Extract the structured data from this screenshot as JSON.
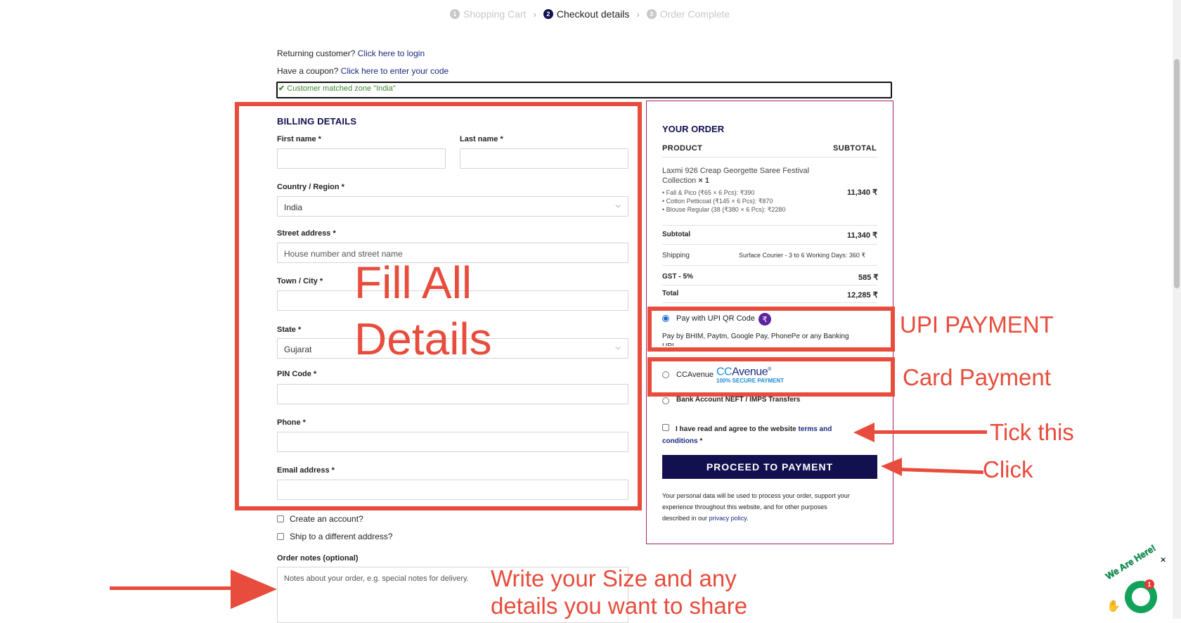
{
  "steps": [
    {
      "num": "1",
      "label": "Shopping Cart"
    },
    {
      "num": "2",
      "label": "Checkout details"
    },
    {
      "num": "3",
      "label": "Order Complete"
    }
  ],
  "returning": {
    "text": "Returning customer?",
    "link": "Click here to login"
  },
  "coupon": {
    "text": "Have a coupon?",
    "link": "Click here to enter your code"
  },
  "zone_message": "Customer matched zone \"India\"",
  "billing": {
    "title": "BILLING DETAILS",
    "first_name_label": "First name *",
    "last_name_label": "Last name *",
    "country_label": "Country / Region *",
    "country_value": "India",
    "street_label": "Street address *",
    "street_placeholder": "House number and street name",
    "town_label": "Town / City *",
    "state_label": "State *",
    "state_value": "Gujarat",
    "pin_label": "PIN Code *",
    "phone_label": "Phone *",
    "email_label": "Email address *",
    "create_account": "Create an account?",
    "ship_different": "Ship to a different address?",
    "notes_label": "Order notes (optional)",
    "notes_placeholder": "Notes about your order, e.g. special notes for delivery."
  },
  "order": {
    "title": "YOUR ORDER",
    "col_product": "PRODUCT",
    "col_subtotal": "SUBTOTAL",
    "item_name_line1": "Laxmi 926 Creap Georgette Saree Festival",
    "item_name_line2": "Collection",
    "item_qty": "× 1",
    "item_options": [
      "• Fall & Pico (₹65 × 6 Pcs): ₹390",
      "• Cotton Petticoat (₹145 × 6 Pcs): ₹870",
      "• Blouse Regular (38 (₹380 × 6 Pcs): ₹2280"
    ],
    "item_amount": "11,340 ₹",
    "subtotal_label": "Subtotal",
    "subtotal_value": "11,340 ₹",
    "shipping_label": "Shipping",
    "shipping_value": "Surface Courier - 3 to 6 Working Days: 360 ₹",
    "gst_label": "GST - 5%",
    "gst_value": "585 ₹",
    "total_label": "Total",
    "total_value": "12,285 ₹"
  },
  "payment": {
    "upi_label": "Pay with UPI QR Code",
    "upi_desc": "Pay by BHIM, Paytm, Google Pay, PhonePe or any Banking",
    "upi_desc_2": "UPI",
    "ccavenue_label": "CCAvenue",
    "ccavenue_logo": "CCAvenue",
    "ccavenue_logo_cc": "CC",
    "ccavenue_logo_avenue": "Avenue",
    "ccavenue_logo_reg": "®",
    "ccavenue_tag": "100% SECURE PAYMENT",
    "neft_label": "Bank Account NEFT / IMPS Transfers",
    "terms_text": "I have read and agree to the website",
    "terms_link": "terms and conditions",
    "terms_req": "*",
    "button": "PROCEED TO PAYMENT",
    "privacy_text_1": "Your personal data will be used to process your order, support your",
    "privacy_text_2": "experience throughout this website, and for other purposes",
    "privacy_text_3": "described in our",
    "privacy_link": "privacy policy",
    "privacy_end": "."
  },
  "annotations": {
    "fill_line1": "Fill All",
    "fill_line2": "Details",
    "upi": "UPI PAYMENT",
    "card": "Card Payment",
    "tick": "Tick this",
    "click": "Click",
    "notes_line1": "Write your Size and any",
    "notes_line2": "details you want to share"
  },
  "chat": {
    "badge": "1",
    "banner": "We Are Here!",
    "close": "✕"
  },
  "colors": {
    "navy": "#12104f",
    "annotation_red": "#e74c3c",
    "link": "#1b2a80",
    "success": "#3d8b2c",
    "panel_border": "#a0236e"
  }
}
